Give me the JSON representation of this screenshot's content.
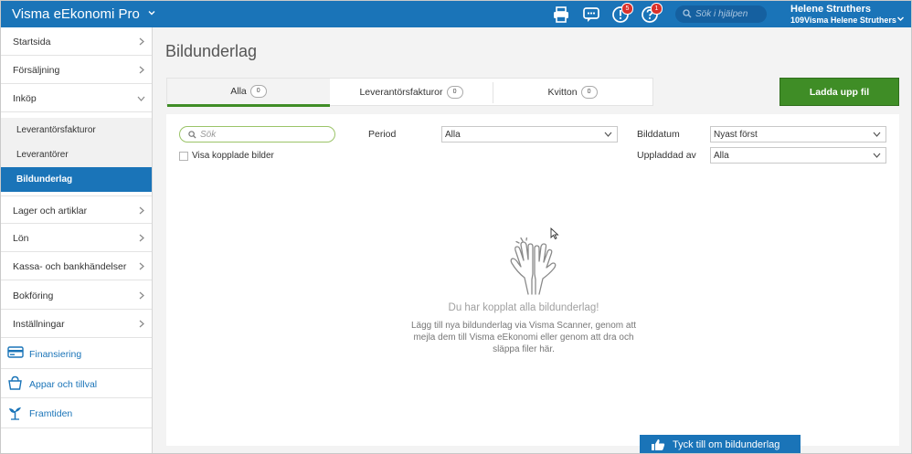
{
  "topbar": {
    "app_title": "Visma eEkonomi Pro",
    "search_placeholder": "Sök i hjälpen",
    "messages_badge": "5",
    "help_badge": "1",
    "user_name": "Helene Struthers",
    "user_company": "109Visma Helene Struthers",
    "colors": {
      "bar": "#1a74b8",
      "badge": "#d9312b"
    }
  },
  "sidebar": {
    "items": [
      {
        "label": "Startsida"
      },
      {
        "label": "Försäljning"
      },
      {
        "label": "Inköp"
      },
      {
        "label": "Leverantörsfakturor"
      },
      {
        "label": "Leverantörer"
      },
      {
        "label": "Bildunderlag"
      },
      {
        "label": "Lager och artiklar"
      },
      {
        "label": "Lön"
      },
      {
        "label": "Kassa- och bankhändelser"
      },
      {
        "label": "Bokföring"
      },
      {
        "label": "Inställningar"
      },
      {
        "label": "Finansiering",
        "icon": "card-icon"
      },
      {
        "label": "Appar och tillval",
        "icon": "basket-icon"
      },
      {
        "label": "Framtiden",
        "icon": "sprout-icon"
      }
    ],
    "active_item": "Bildunderlag"
  },
  "main": {
    "title": "Bildunderlag",
    "tabs": [
      {
        "label": "Alla",
        "count": "0"
      },
      {
        "label": "Leverantörsfakturor",
        "count": "0"
      },
      {
        "label": "Kvitton",
        "count": "0"
      }
    ],
    "upload_button": "Ladda upp fil",
    "filters": {
      "search_placeholder": "Sök",
      "show_linked_label": "Visa kopplade bilder",
      "period_label": "Period",
      "period_value": "Alla",
      "image_date_label": "Bilddatum",
      "image_date_value": "Nyast först",
      "uploaded_by_label": "Uppladdad av",
      "uploaded_by_value": "Alla"
    },
    "empty_state": {
      "title": "Du har kopplat alla bildunderlag!",
      "text": "Lägg till nya bildunderlag via Visma Scanner, genom att mejla dem till Visma eEkonomi eller genom att dra och släppa filer här."
    },
    "feedback_button": "Tyck till om bildunderlag",
    "colors": {
      "green": "#3f8d26",
      "blue": "#1a74b8"
    }
  }
}
